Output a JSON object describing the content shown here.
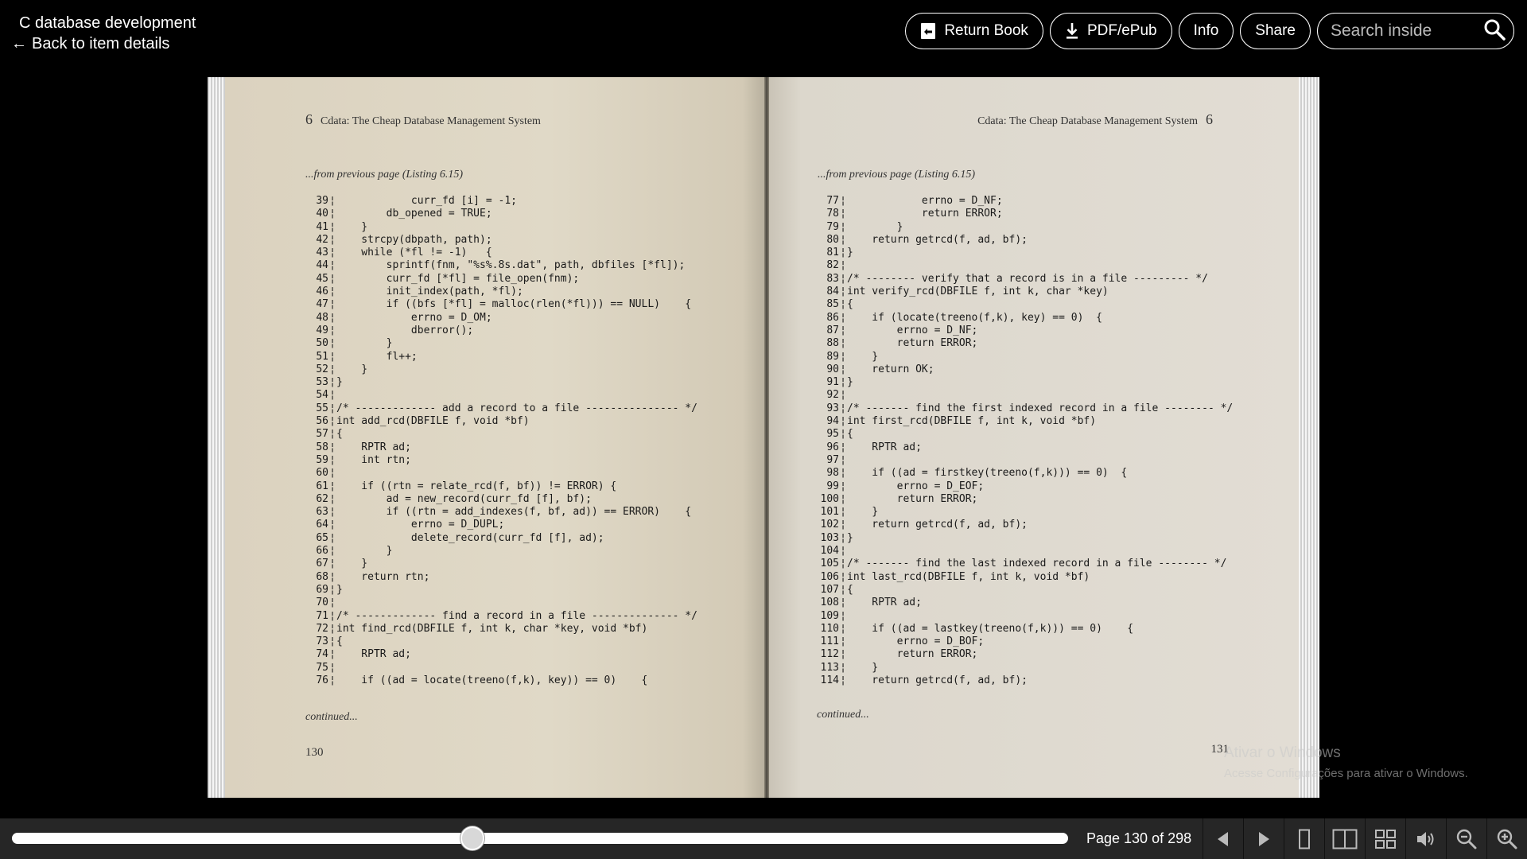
{
  "header": {
    "title": "C database development",
    "back_label": "Back to item details",
    "actions": {
      "return_book": "Return Book",
      "pdf_epub": "PDF/ePub",
      "info": "Info",
      "share": "Share"
    },
    "search_placeholder": "Search inside"
  },
  "book": {
    "left": {
      "chapter": "6",
      "running_head": "Cdata: The Cheap Database Management System",
      "from_previous": "...from previous page (Listing 6.15)",
      "continued": "continued...",
      "page_number": "130",
      "lines": [
        {
          "n": "39",
          "t": "            curr_fd [i] = -1;"
        },
        {
          "n": "40",
          "t": "        db_opened = TRUE;"
        },
        {
          "n": "41",
          "t": "    }"
        },
        {
          "n": "42",
          "t": "    strcpy(dbpath, path);"
        },
        {
          "n": "43",
          "t": "    while (*fl != -1)   {"
        },
        {
          "n": "44",
          "t": "        sprintf(fnm, \"%s%.8s.dat\", path, dbfiles [*fl]);"
        },
        {
          "n": "45",
          "t": "        curr_fd [*fl] = file_open(fnm);"
        },
        {
          "n": "46",
          "t": "        init_index(path, *fl);"
        },
        {
          "n": "47",
          "t": "        if ((bfs [*fl] = malloc(rlen(*fl))) == NULL)    {"
        },
        {
          "n": "48",
          "t": "            errno = D_OM;"
        },
        {
          "n": "49",
          "t": "            dberror();"
        },
        {
          "n": "50",
          "t": "        }"
        },
        {
          "n": "51",
          "t": "        fl++;"
        },
        {
          "n": "52",
          "t": "    }"
        },
        {
          "n": "53",
          "t": "}"
        },
        {
          "n": "54",
          "t": ""
        },
        {
          "n": "55",
          "t": "/* ------------- add a record to a file --------------- */"
        },
        {
          "n": "56",
          "t": "int add_rcd(DBFILE f, void *bf)"
        },
        {
          "n": "57",
          "t": "{"
        },
        {
          "n": "58",
          "t": "    RPTR ad;"
        },
        {
          "n": "59",
          "t": "    int rtn;"
        },
        {
          "n": "60",
          "t": ""
        },
        {
          "n": "61",
          "t": "    if ((rtn = relate_rcd(f, bf)) != ERROR) {"
        },
        {
          "n": "62",
          "t": "        ad = new_record(curr_fd [f], bf);"
        },
        {
          "n": "63",
          "t": "        if ((rtn = add_indexes(f, bf, ad)) == ERROR)    {"
        },
        {
          "n": "64",
          "t": "            errno = D_DUPL;"
        },
        {
          "n": "65",
          "t": "            delete_record(curr_fd [f], ad);"
        },
        {
          "n": "66",
          "t": "        }"
        },
        {
          "n": "67",
          "t": "    }"
        },
        {
          "n": "68",
          "t": "    return rtn;"
        },
        {
          "n": "69",
          "t": "}"
        },
        {
          "n": "70",
          "t": ""
        },
        {
          "n": "71",
          "t": "/* ------------- find a record in a file -------------- */"
        },
        {
          "n": "72",
          "t": "int find_rcd(DBFILE f, int k, char *key, void *bf)"
        },
        {
          "n": "73",
          "t": "{"
        },
        {
          "n": "74",
          "t": "    RPTR ad;"
        },
        {
          "n": "75",
          "t": ""
        },
        {
          "n": "76",
          "t": "    if ((ad = locate(treeno(f,k), key)) == 0)    {"
        }
      ]
    },
    "right": {
      "chapter": "6",
      "running_head": "Cdata: The Cheap Database Management System",
      "from_previous": "...from previous page (Listing 6.15)",
      "continued": "continued...",
      "page_number": "131",
      "lines": [
        {
          "n": "77",
          "t": "            errno = D_NF;"
        },
        {
          "n": "78",
          "t": "            return ERROR;"
        },
        {
          "n": "79",
          "t": "        }"
        },
        {
          "n": "80",
          "t": "    return getrcd(f, ad, bf);"
        },
        {
          "n": "81",
          "t": "}"
        },
        {
          "n": "82",
          "t": ""
        },
        {
          "n": "83",
          "t": "/* -------- verify that a record is in a file --------- */"
        },
        {
          "n": "84",
          "t": "int verify_rcd(DBFILE f, int k, char *key)"
        },
        {
          "n": "85",
          "t": "{"
        },
        {
          "n": "86",
          "t": "    if (locate(treeno(f,k), key) == 0)  {"
        },
        {
          "n": "87",
          "t": "        errno = D_NF;"
        },
        {
          "n": "88",
          "t": "        return ERROR;"
        },
        {
          "n": "89",
          "t": "    }"
        },
        {
          "n": "90",
          "t": "    return OK;"
        },
        {
          "n": "91",
          "t": "}"
        },
        {
          "n": "92",
          "t": ""
        },
        {
          "n": "93",
          "t": "/* ------- find the first indexed record in a file -------- */"
        },
        {
          "n": "94",
          "t": "int first_rcd(DBFILE f, int k, void *bf)"
        },
        {
          "n": "95",
          "t": "{"
        },
        {
          "n": "96",
          "t": "    RPTR ad;"
        },
        {
          "n": "97",
          "t": ""
        },
        {
          "n": "98",
          "t": "    if ((ad = firstkey(treeno(f,k))) == 0)  {"
        },
        {
          "n": "99",
          "t": "        errno = D_EOF;"
        },
        {
          "n": "100",
          "t": "        return ERROR;"
        },
        {
          "n": "101",
          "t": "    }"
        },
        {
          "n": "102",
          "t": "    return getrcd(f, ad, bf);"
        },
        {
          "n": "103",
          "t": "}"
        },
        {
          "n": "104",
          "t": ""
        },
        {
          "n": "105",
          "t": "/* ------- find the last indexed record in a file -------- */"
        },
        {
          "n": "106",
          "t": "int last_rcd(DBFILE f, int k, void *bf)"
        },
        {
          "n": "107",
          "t": "{"
        },
        {
          "n": "108",
          "t": "    RPTR ad;"
        },
        {
          "n": "109",
          "t": ""
        },
        {
          "n": "110",
          "t": "    if ((ad = lastkey(treeno(f,k))) == 0)    {"
        },
        {
          "n": "111",
          "t": "        errno = D_BOF;"
        },
        {
          "n": "112",
          "t": "        return ERROR;"
        },
        {
          "n": "113",
          "t": "    }"
        },
        {
          "n": "114",
          "t": "    return getrcd(f, ad, bf);"
        }
      ]
    }
  },
  "watermark": {
    "line1": "Ativar o Windows",
    "line2": "Acesse Configurações para ativar o Windows."
  },
  "footer": {
    "page_indicator": "Page 130 of 298",
    "progress_fraction": 0.4362
  },
  "icons": {
    "return_book": "return-book-icon",
    "download": "download-icon",
    "search": "search-icon",
    "prev": "previous-page-icon",
    "next": "next-page-icon",
    "one_page": "one-page-view-icon",
    "two_page": "two-page-view-icon",
    "thumbnails": "thumbnail-view-icon",
    "read_aloud": "read-aloud-icon",
    "zoom_out": "zoom-out-icon",
    "zoom_in": "zoom-in-icon"
  }
}
